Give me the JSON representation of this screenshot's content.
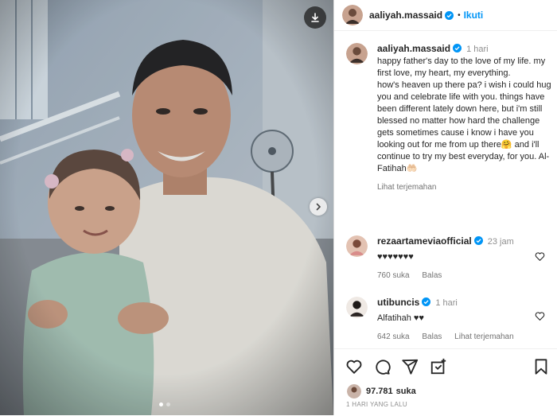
{
  "post": {
    "username": "aaliyah.massaid",
    "separator": "•",
    "follow_label": "Ikuti",
    "caption_time": "1 hari",
    "caption": "happy father's day to the love of my life. my first love, my heart, my everything.\nhow's heaven up there pa? i wish i could hug you and celebrate life with you. things have been different lately down here, but i'm still blessed no matter how hard the challenge gets sometimes cause i know i have you looking out for me from up there🤗 and i'll continue to try my best everyday, for you. Al-Fatihah🤲🏻",
    "translate_label": "Lihat terjemahan"
  },
  "comments": [
    {
      "username": "rezaartameviaofficial",
      "time": "23 jam",
      "text": "♥♥♥♥♥♥♥",
      "likes": "760 suka",
      "reply": "Balas",
      "translate": ""
    },
    {
      "username": "utibuncis",
      "time": "1 hari",
      "text": "Alfatihah ♥♥",
      "likes": "642 suka",
      "reply": "Balas",
      "translate": "Lihat terjemahan"
    }
  ],
  "footer": {
    "likes_count": "97.781",
    "likes_suffix": "suka",
    "date": "1 HARI YANG LALU"
  },
  "icons": [
    "download-icon",
    "chevron-right-icon",
    "heart-icon",
    "comment-icon",
    "share-icon",
    "add-to-story-icon",
    "bookmark-icon",
    "verified-icon"
  ],
  "colors": {
    "accent": "#0095f6",
    "verified": "#0095f6",
    "muted": "#8e8e8e"
  },
  "carousel": {
    "slides": 2,
    "active": 1
  }
}
